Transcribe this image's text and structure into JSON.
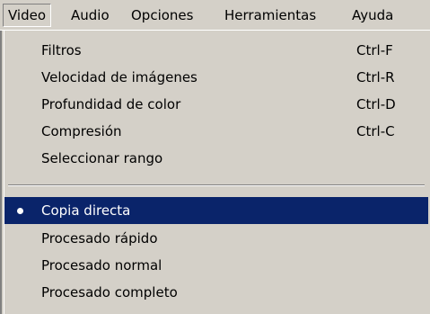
{
  "menubar": {
    "items": [
      {
        "label": "Video"
      },
      {
        "label": "Audio"
      },
      {
        "label": "Opciones"
      },
      {
        "label": "Herramientas"
      },
      {
        "label": "Ayuda"
      }
    ]
  },
  "video_menu": {
    "items": [
      {
        "label": "Filtros",
        "shortcut": "Ctrl-F"
      },
      {
        "label": "Velocidad de imágenes",
        "shortcut": "Ctrl-R"
      },
      {
        "label": "Profundidad de color",
        "shortcut": "Ctrl-D"
      },
      {
        "label": "Compresión",
        "shortcut": "Ctrl-C"
      },
      {
        "label": "Seleccionar rango"
      }
    ],
    "mode_items": [
      {
        "label": "Copia directa",
        "checked": true,
        "highlighted": true
      },
      {
        "label": "Procesado rápido"
      },
      {
        "label": "Procesado normal"
      },
      {
        "label": "Procesado completo"
      }
    ]
  },
  "colors": {
    "menu_background": "#d4d0c8",
    "highlight": "#0a246a",
    "highlight_text": "#ffffff"
  }
}
